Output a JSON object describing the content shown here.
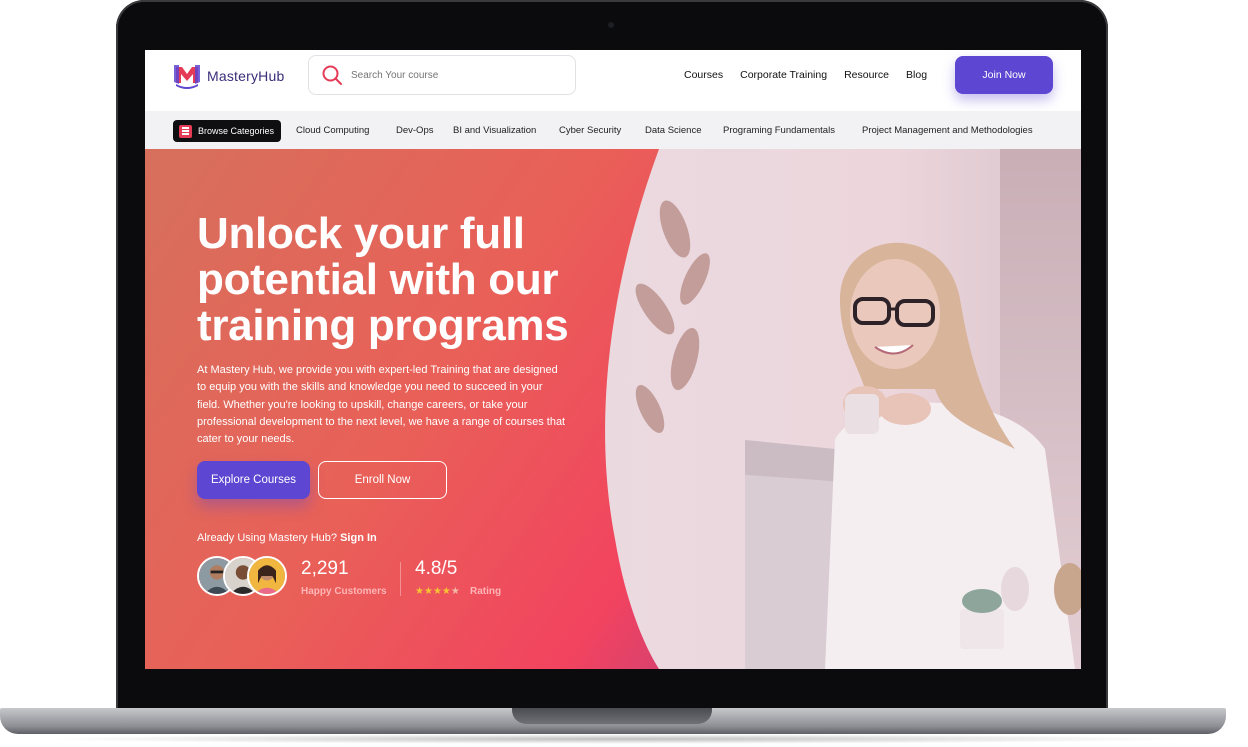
{
  "brand": {
    "name": "MasteryHub"
  },
  "search": {
    "placeholder": "Search Your course"
  },
  "nav": {
    "items": [
      {
        "label": "Courses"
      },
      {
        "label": "Corporate Training"
      },
      {
        "label": "Resource"
      },
      {
        "label": "Blog"
      }
    ],
    "join_label": "Join Now"
  },
  "categories": {
    "browse_label": "Browse Categories",
    "items": [
      {
        "label": "Cloud Computing"
      },
      {
        "label": "Dev-Ops"
      },
      {
        "label": "BI and Visualization"
      },
      {
        "label": "Cyber Security"
      },
      {
        "label": "Data Science"
      },
      {
        "label": "Programing Fundamentals"
      },
      {
        "label": "Project Management and Methodologies"
      }
    ]
  },
  "hero": {
    "headline": "Unlock your full potential with our training programs",
    "description": "At Mastery Hub, we provide you with expert-led Training that are designed to equip you with the skills and knowledge you need to succeed in your field. Whether you're looking to upskill, change careers, or take your professional development to the next level, we have a range of courses that cater to your needs.",
    "explore_label": "Explore Courses",
    "enroll_label": "Enroll Now",
    "already_text": "Already Using Mastery Hub?",
    "sign_in_label": "Sign In",
    "customers_count": "2,291",
    "customers_label": "Happy Customers",
    "rating_value": "4.8/5",
    "rating_label": "Rating",
    "rating_stars": 4
  },
  "colors": {
    "accent": "#5d46d1",
    "brand_red": "#e53b56",
    "star": "#f7c233"
  }
}
